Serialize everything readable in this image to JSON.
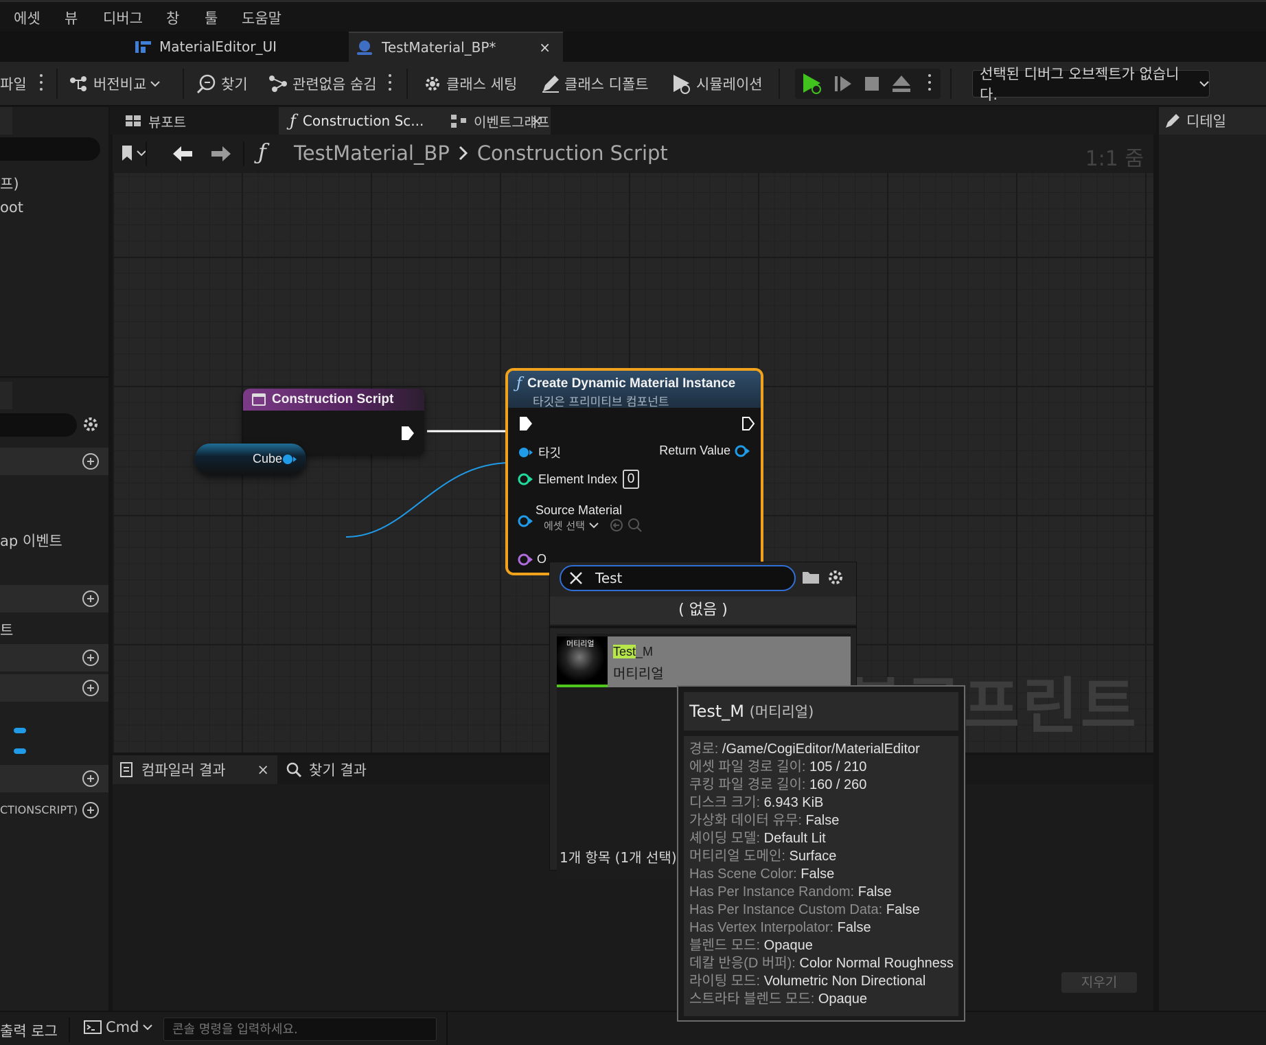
{
  "menu": [
    "에셋",
    "뷰",
    "디버그",
    "창",
    "툴",
    "도움말"
  ],
  "doc_tabs": [
    {
      "label": "MaterialEditor_UI"
    },
    {
      "label": "TestMaterial_BP*",
      "close": "×"
    }
  ],
  "toolbar": {
    "file": "파일",
    "diff": "버전비교",
    "find": "찾기",
    "hide_unrelated": "관련없음 숨김",
    "class_settings": "클래스 세팅",
    "class_defaults": "클래스 디폴트",
    "simulation": "시뮬레이션",
    "debug_object": "선택된 디버그 오브젝트가 없습니다."
  },
  "graph_tabs": {
    "viewport": "뷰포트",
    "construction": "Construction Sc...",
    "construction_close": "×",
    "event_graph": "이벤트그래프",
    "details": "디테일"
  },
  "breadcrumb": {
    "blueprint": "TestMaterial_BP",
    "graph": "Construction Script",
    "zoom": "1:1 줌"
  },
  "left_panel": {
    "frag1": "프)",
    "frag2": "oot",
    "frag3": "ap 이벤트",
    "frag4": "트",
    "frag5": "CTIONSCRIPT)"
  },
  "canvas_watermark": "블루프린트",
  "nodes": {
    "construction_script": {
      "title": "Construction Script",
      "color": "#7b3a86"
    },
    "cube": {
      "label": "Cube",
      "pin_color": "#1f9be8"
    },
    "create_dmi": {
      "title": "Create Dynamic Material Instance",
      "subtitle": "타깃은 프리미티브 컴포넌트",
      "target": "타깃",
      "return_value": "Return Value",
      "element_index": "Element Index",
      "element_index_value": "0",
      "source_material": "Source Material",
      "asset_select": "에셋 선택",
      "last_pin_fragment": "O",
      "highlight_color": "#f0a21c"
    }
  },
  "asset_picker": {
    "search_value": "Test",
    "none_option": "( 없음 )",
    "item_badge": "머티리얼",
    "item_name_match": "Test",
    "item_name_rest": "_M",
    "item_type": "머티리얼",
    "count": "1개 항목 (1개 선택)"
  },
  "tooltip": {
    "title": "Test_M",
    "title_type": "(머티리얼)",
    "rows": [
      {
        "k": "경로: ",
        "v": "/Game/CogiEditor/MaterialEditor"
      },
      {
        "k": "에셋 파일 경로 길이: ",
        "v": "105 / 210"
      },
      {
        "k": "쿠킹 파일 경로 길이: ",
        "v": "160 / 260"
      },
      {
        "k": "디스크 크기: ",
        "v": "6.943 KiB"
      },
      {
        "k": "가상화 데이터 유무: ",
        "v": "False"
      },
      {
        "k": "셰이딩 모델: ",
        "v": "Default Lit"
      },
      {
        "k": "머티리얼 도메인: ",
        "v": "Surface"
      },
      {
        "k": "Has Scene Color: ",
        "v": "False"
      },
      {
        "k": "Has Per Instance Random: ",
        "v": "False"
      },
      {
        "k": "Has Per Instance Custom Data: ",
        "v": "False"
      },
      {
        "k": "Has Vertex Interpolator: ",
        "v": "False"
      },
      {
        "k": "블렌드 모드: ",
        "v": "Opaque"
      },
      {
        "k": "데칼 반응(D 버퍼): ",
        "v": "Color Normal Roughness"
      },
      {
        "k": "라이팅 모드: ",
        "v": "Volumetric Non Directional"
      },
      {
        "k": "스트라타 블렌드 모드: ",
        "v": "Opaque"
      }
    ]
  },
  "bottom": {
    "compiler_tab": "컴파일러 결과",
    "compiler_close": "×",
    "find_tab": "찾기 결과",
    "clear": "지우기"
  },
  "status": {
    "output_log": "출력 로그",
    "cmd": "Cmd",
    "console_placeholder": "콘솔 명령을 입력하세요."
  }
}
